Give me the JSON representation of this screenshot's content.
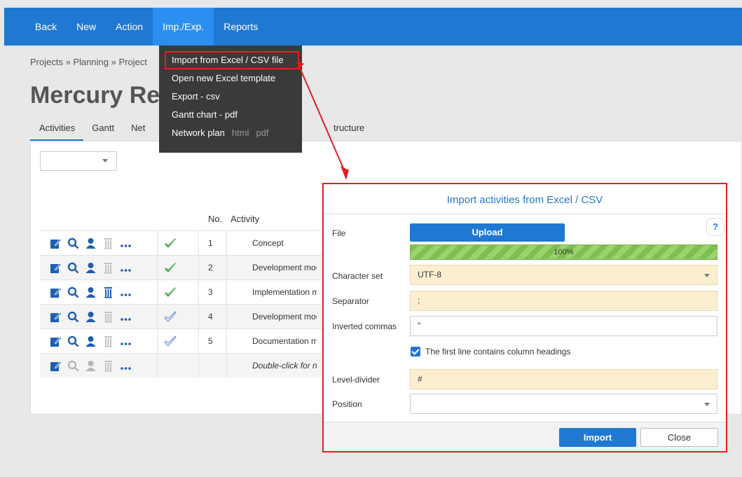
{
  "nav": {
    "items": [
      {
        "label": "Back",
        "active": false
      },
      {
        "label": "New",
        "active": false
      },
      {
        "label": "Action",
        "active": false
      },
      {
        "label": "Imp./Exp.",
        "active": true
      },
      {
        "label": "Reports",
        "active": false
      }
    ]
  },
  "breadcrumb": "Projects » Planning » Project",
  "page_title": "Mercury Re",
  "tabs": [
    "Activities",
    "Gantt",
    "Net",
    "tructure"
  ],
  "table": {
    "headers": {
      "no": "No.",
      "activity": "Activity"
    },
    "rows": [
      {
        "no": "1",
        "activity": "Concept",
        "status": "done"
      },
      {
        "no": "2",
        "activity": "Development moc",
        "status": "done"
      },
      {
        "no": "3",
        "activity": "Implementation m",
        "status": "done"
      },
      {
        "no": "4",
        "activity": "Development moc",
        "status": "open"
      },
      {
        "no": "5",
        "activity": "Documentation m",
        "status": "open"
      },
      {
        "no": "",
        "activity": "Double-click for ne",
        "status": "new"
      }
    ]
  },
  "dropdown": {
    "items": [
      {
        "label": "Import from Excel / CSV file",
        "highlight": true
      },
      {
        "label": "Open new Excel template"
      },
      {
        "label": "Export - csv"
      },
      {
        "label": "Gantt chart - pdf"
      },
      {
        "label": "Network plan",
        "extras": [
          "html",
          "pdf"
        ]
      }
    ]
  },
  "dialog": {
    "title": "Import activities from Excel / CSV",
    "help": "?",
    "file_label": "File",
    "upload_label": "Upload",
    "progress_text": "100%",
    "progress_value": 100,
    "charset_label": "Character set",
    "charset_value": "UTF-8",
    "separator_label": "Separator",
    "separator_value": ";",
    "quotes_label": "Inverted commas",
    "quotes_value": "\"",
    "first_line_label": "The first line contains column headings",
    "first_line_checked": true,
    "level_divider_label": "Level-divider",
    "level_divider_value": "#",
    "position_label": "Position",
    "position_value": "",
    "import_label": "Import",
    "close_label": "Close"
  },
  "colors": {
    "nav": "#1f78d1",
    "accent": "#1f78d1",
    "highlight_border": "#e02020",
    "check_done": "#4caf50",
    "check_open": "#6b9bd8"
  }
}
